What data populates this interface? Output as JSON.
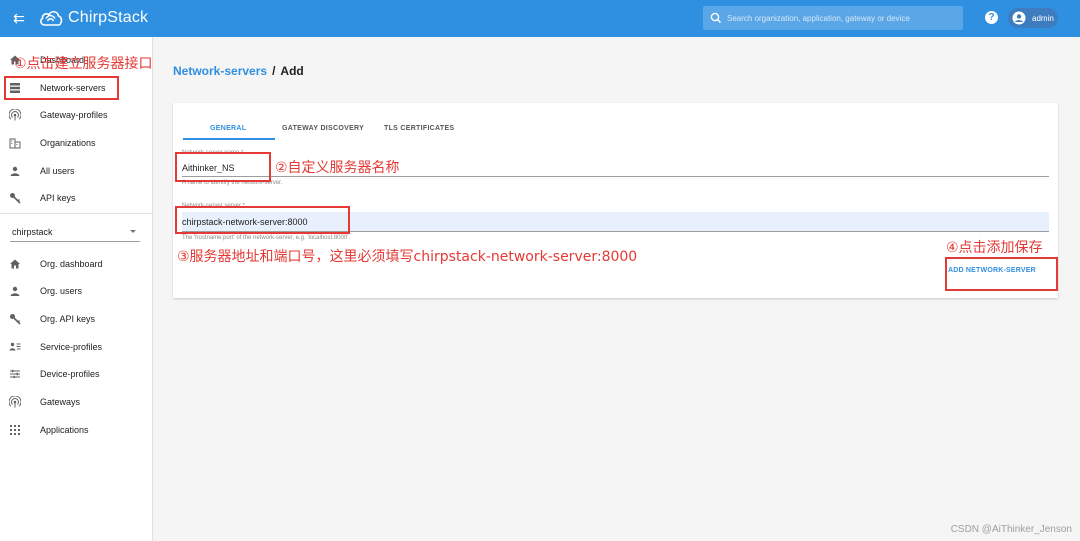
{
  "topbar": {
    "brand": "ChirpStack",
    "search_placeholder": "Search organization, application, gateway or device",
    "help": "?",
    "user": "admin"
  },
  "sidebar": {
    "global_items": [
      {
        "label": "Dashboard",
        "icon": "home-icon"
      },
      {
        "label": "Network-servers",
        "icon": "server-icon"
      },
      {
        "label": "Gateway-profiles",
        "icon": "gateway-profile-icon"
      },
      {
        "label": "Organizations",
        "icon": "organization-icon"
      },
      {
        "label": "All users",
        "icon": "user-icon"
      },
      {
        "label": "API keys",
        "icon": "key-icon"
      }
    ],
    "org_selected": "chirpstack",
    "org_items": [
      {
        "label": "Org. dashboard",
        "icon": "home-icon"
      },
      {
        "label": "Org. users",
        "icon": "user-icon"
      },
      {
        "label": "Org. API keys",
        "icon": "key-icon"
      },
      {
        "label": "Service-profiles",
        "icon": "service-profile-icon"
      },
      {
        "label": "Device-profiles",
        "icon": "device-profile-icon"
      },
      {
        "label": "Gateways",
        "icon": "gateway-icon"
      },
      {
        "label": "Applications",
        "icon": "apps-icon"
      }
    ]
  },
  "breadcrumb": {
    "parent": "Network-servers",
    "separator": "/",
    "current": "Add"
  },
  "tabs": [
    "GENERAL",
    "GATEWAY DISCOVERY",
    "TLS CERTIFICATES"
  ],
  "form": {
    "name_label": "Network-server name *",
    "name_value": "Aithinker_NS",
    "name_help": "A name to identify the network-server.",
    "server_label": "Network-server server *",
    "server_value": "chirpstack-network-server:8000",
    "server_help": "The 'hostname:port' of the network-server, e.g. 'localhost:8000'.",
    "submit": "ADD NETWORK-SERVER"
  },
  "annotations": {
    "step1": "①点击建立服务器接口",
    "step2": "②自定义服务器名称",
    "step3": "③服务器地址和端口号，这里必须填写chirpstack-network-server:8000",
    "step4": "④点击添加保存"
  },
  "watermark": "CSDN @AiThinker_Jenson",
  "colors": {
    "primary": "#2f8fe0",
    "annotation": "#e53935"
  }
}
